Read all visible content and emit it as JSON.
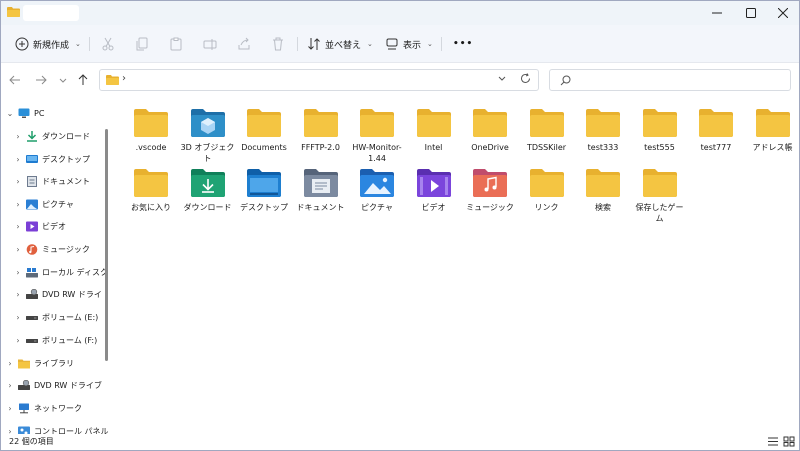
{
  "toolbar": {
    "new_label": "新規作成",
    "sort_label": "並べ替え",
    "view_label": "表示",
    "more_label": "•••"
  },
  "address": {
    "separator": "›"
  },
  "nav": {
    "items": [
      {
        "label": "PC",
        "icon": "pc-icon",
        "chev": "⌄",
        "color": "#2a8fd8"
      },
      {
        "label": "ダウンロード",
        "icon": "download-icon",
        "chev": "›",
        "color": "#1f9e6a"
      },
      {
        "label": "デスクトップ",
        "icon": "desktop-icon",
        "chev": "›",
        "color": "#1e7bd0"
      },
      {
        "label": "ドキュメント",
        "icon": "document-icon",
        "chev": "›",
        "color": "#6e7b8f"
      },
      {
        "label": "ピクチャ",
        "icon": "picture-icon",
        "chev": "›",
        "color": "#2b7fd4"
      },
      {
        "label": "ビデオ",
        "icon": "video-icon",
        "chev": "›",
        "color": "#7b3fd6"
      },
      {
        "label": "ミュージック",
        "icon": "music-icon",
        "chev": "›",
        "color": "#e0603e"
      },
      {
        "label": "ローカル ディスク",
        "icon": "local-disk-icon",
        "chev": "›",
        "color": "#4a6fa5"
      },
      {
        "label": "DVD RW ドライ",
        "icon": "dvd-drive-icon",
        "chev": "›",
        "color": "#555555"
      },
      {
        "label": "ボリューム (E:)",
        "icon": "drive-icon",
        "chev": "›",
        "color": "#444444"
      },
      {
        "label": "ボリューム (F:)",
        "icon": "drive-icon",
        "chev": "›",
        "color": "#444444"
      },
      {
        "label": "ライブラリ",
        "icon": "library-icon",
        "chev": "›",
        "color": "#e8b43a"
      },
      {
        "label": "DVD RW ドライブ",
        "icon": "dvd-drive-icon",
        "chev": "›",
        "color": "#555555"
      },
      {
        "label": "ネットワーク",
        "icon": "network-icon",
        "chev": "›",
        "color": "#2a7bd0"
      },
      {
        "label": "コントロール パネル",
        "icon": "control-panel-icon",
        "chev": "›",
        "color": "#3b8bd8"
      }
    ]
  },
  "files": [
    {
      "name": ".vscode",
      "icon": "folder"
    },
    {
      "name": "3D オブジェクト",
      "icon": "3d"
    },
    {
      "name": "Documents",
      "icon": "folder"
    },
    {
      "name": "FFFTP-2.0",
      "icon": "folder"
    },
    {
      "name": "HW-Monitor-1.44",
      "icon": "folder"
    },
    {
      "name": "Intel",
      "icon": "folder"
    },
    {
      "name": "OneDrive",
      "icon": "folder"
    },
    {
      "name": "TDSSKiler",
      "icon": "folder"
    },
    {
      "name": "test333",
      "icon": "folder"
    },
    {
      "name": "test555",
      "icon": "folder"
    },
    {
      "name": "test777",
      "icon": "folder"
    },
    {
      "name": "アドレス帳",
      "icon": "folder"
    },
    {
      "name": "お気に入り",
      "icon": "folder"
    },
    {
      "name": "ダウンロード",
      "icon": "download"
    },
    {
      "name": "デスクトップ",
      "icon": "desktop"
    },
    {
      "name": "ドキュメント",
      "icon": "document"
    },
    {
      "name": "ピクチャ",
      "icon": "picture"
    },
    {
      "name": "ビデオ",
      "icon": "video"
    },
    {
      "name": "ミュージック",
      "icon": "music"
    },
    {
      "name": "リンク",
      "icon": "folder"
    },
    {
      "name": "検索",
      "icon": "folder"
    },
    {
      "name": "保存したゲーム",
      "icon": "folder"
    }
  ],
  "status": {
    "item_count": "22 個の項目"
  },
  "colors": {
    "folder": "#f4c542",
    "folder_back": "#e8b12f",
    "accent": "#0067c0"
  }
}
